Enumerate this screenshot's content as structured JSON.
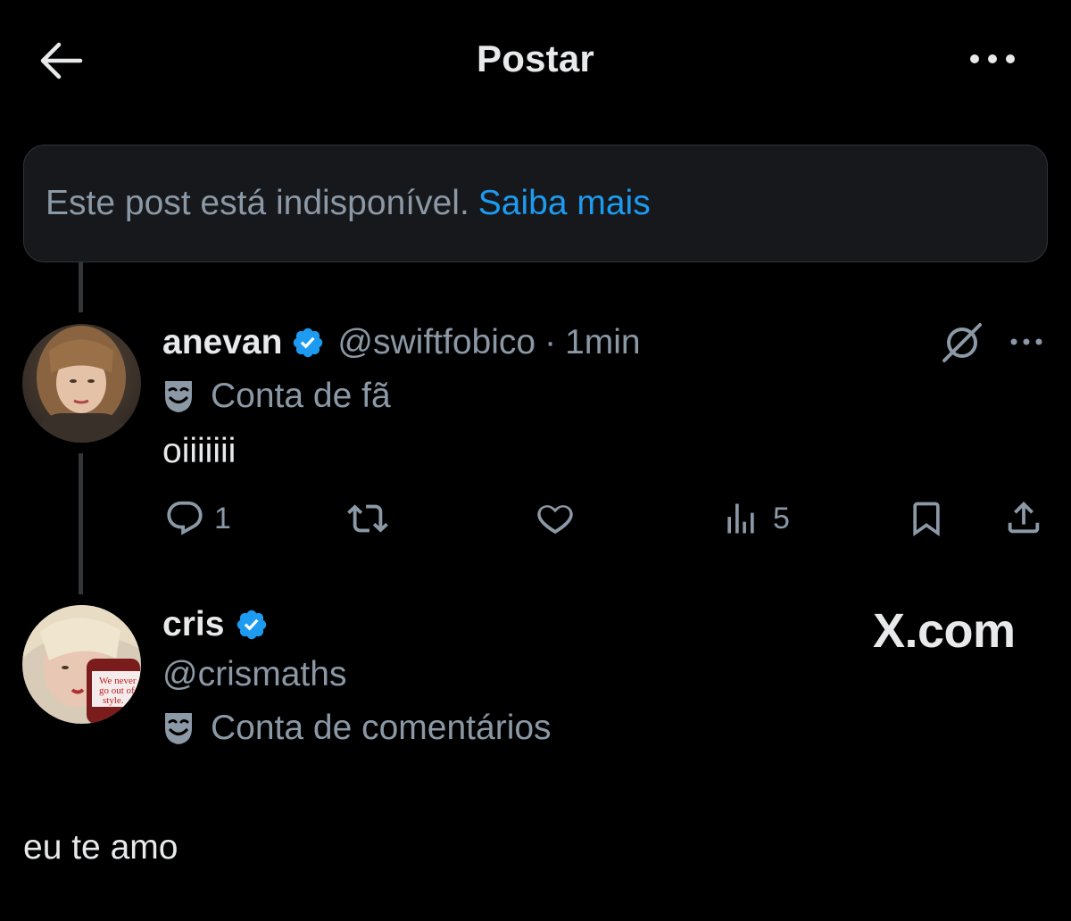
{
  "header": {
    "title": "Postar",
    "back_icon": "arrow-left-icon",
    "more_icon": "more-horizontal-icon"
  },
  "notice": {
    "text": "Este post está indisponível.",
    "link": "Saiba mais"
  },
  "tweet": {
    "name": "anevan",
    "handle": "@swiftfobico",
    "separator": "·",
    "time": "1min",
    "label": "Conta de fã",
    "text": "oiiiiiii",
    "actions": {
      "reply_count": "1",
      "retweet_count": "",
      "like_count": "",
      "views_count": "5"
    }
  },
  "reply": {
    "name": "cris",
    "handle": "@crismaths",
    "label": "Conta de comentários",
    "text": "eu te amo"
  },
  "watermark": "X.com",
  "colors": {
    "background": "#000000",
    "accent": "#1d9bf0",
    "muted": "#8b98a5",
    "text": "#e7e9ea"
  }
}
